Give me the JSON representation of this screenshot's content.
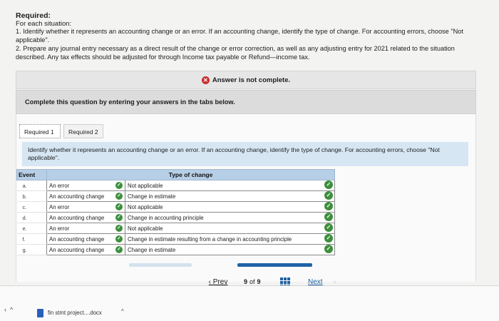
{
  "header": {
    "required": "Required:",
    "situation": "For each situation:",
    "instruction_1": "1. Identify whether it represents an accounting change or an error. If an accounting change, identify the type of change. For accounting errors, choose \"Not applicable\".",
    "instruction_2": "2. Prepare any journal entry necessary as a direct result of the change or error correction, as well as any adjusting entry for 2021 related to the situation described. Any tax effects should be adjusted for through Income tax payable or Refund—income tax."
  },
  "status": {
    "message": "Answer is not complete.",
    "icon": "x-circle-icon",
    "color": "#c9302c"
  },
  "prompt": "Complete this question by entering your answers in the tabs below.",
  "tabs": [
    {
      "label": "Required 1",
      "active": true
    },
    {
      "label": "Required 2",
      "active": false
    }
  ],
  "question": "Identify whether it represents an accounting change or an error. If an accounting change, identify the type of change. For accounting errors, choose \"Not applicable\".",
  "table": {
    "col_event": "Event",
    "col_type": "Type of change",
    "rows": [
      {
        "event": "a.",
        "kind": "An error",
        "type": "Not applicable"
      },
      {
        "event": "b.",
        "kind": "An accounting change",
        "type": "Change in estimate"
      },
      {
        "event": "c.",
        "kind": "An error",
        "type": "Not applicable"
      },
      {
        "event": "d.",
        "kind": "An accounting change",
        "type": "Change in accounting principle"
      },
      {
        "event": "e.",
        "kind": "An error",
        "type": "Not applicable"
      },
      {
        "event": "f.",
        "kind": "An accounting change",
        "type": "Change in estimate resulting from a change in accounting principle"
      },
      {
        "event": "g.",
        "kind": "An accounting change",
        "type": "Change in estimate"
      }
    ]
  },
  "nav": {
    "prev": "Prev",
    "current": "9",
    "of": "of",
    "total": "9",
    "next": "Next",
    "grid_icon": "grid-icon"
  },
  "taskbar": {
    "file": "fin stmt project....docx"
  },
  "colors": {
    "check": "#3d8f3d",
    "accent": "#1f5fa0"
  }
}
